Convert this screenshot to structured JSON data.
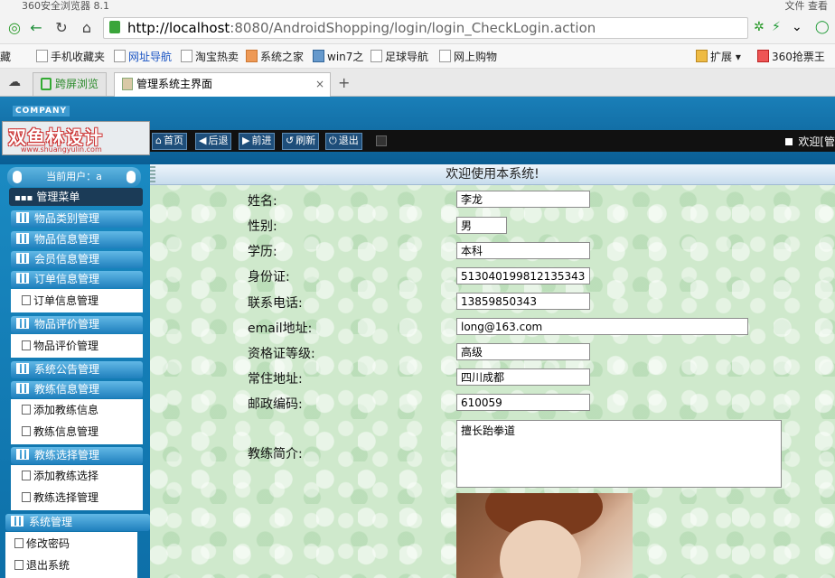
{
  "browser": {
    "title": "360安全浏览器 8.1",
    "title_right": "文件 查看",
    "url_host": "http://localhost",
    "url_path": ":8080/AndroidShopping/login/login_CheckLogin.action",
    "bookmarks": [
      {
        "label": "藏",
        "color": "normal"
      },
      {
        "label": "手机收藏夹",
        "color": "normal"
      },
      {
        "label": "网址导航",
        "color": "blue"
      },
      {
        "label": "淘宝热卖",
        "color": "normal"
      },
      {
        "label": "系统之家",
        "color": "normal"
      },
      {
        "label": "win7之",
        "color": "normal"
      },
      {
        "label": "足球导航",
        "color": "normal"
      },
      {
        "label": "网上购物",
        "color": "normal"
      }
    ],
    "extend_label": "扩展",
    "grab_label": "360抢票王",
    "tabs": [
      {
        "label": "跨屏浏览"
      },
      {
        "label": "管理系统主界面"
      }
    ],
    "new_tab": "+",
    "close_tab": "×"
  },
  "header": {
    "company_tag": "COMPANY",
    "logo_text": "双鱼林设计",
    "logo_url": "www.shuangyulin.com",
    "toolbar": [
      "首页",
      "后退",
      "前进",
      "刷新",
      "退出"
    ],
    "welcome": "欢迎[管"
  },
  "sidebar": {
    "current_user": "当前用户：a",
    "menu_title": "管理菜单",
    "sections": [
      {
        "label": "物品类别管理"
      },
      {
        "label": "物品信息管理"
      },
      {
        "label": "会员信息管理"
      },
      {
        "label": "订单信息管理",
        "items": [
          "订单信息管理"
        ]
      },
      {
        "label": "物品评价管理",
        "items": [
          "物品评价管理"
        ]
      },
      {
        "label": "系统公告管理"
      },
      {
        "label": "教练信息管理",
        "items": [
          "添加教练信息",
          "教练信息管理"
        ]
      },
      {
        "label": "教练选择管理",
        "items": [
          "添加教练选择",
          "教练选择管理"
        ]
      }
    ],
    "system": {
      "label": "系统管理",
      "items": [
        "修改密码",
        "退出系统"
      ]
    }
  },
  "main": {
    "title": "欢迎使用本系统!",
    "fields": [
      {
        "label": "姓名:",
        "value": "李龙"
      },
      {
        "label": "性别:",
        "value": "男"
      },
      {
        "label": "学历:",
        "value": "本科"
      },
      {
        "label": "身份证:",
        "value": "513040199812135343"
      },
      {
        "label": "联系电话:",
        "value": "13859850343"
      },
      {
        "label": "email地址:",
        "value": "long@163.com"
      },
      {
        "label": "资格证等级:",
        "value": "高级"
      },
      {
        "label": "常住地址:",
        "value": "四川成都"
      },
      {
        "label": "邮政编码:",
        "value": "610059"
      }
    ],
    "intro_label": "教练简介:",
    "intro_value": "擅长跆拳道"
  },
  "colors": {
    "header_blue": "#1a7fb8",
    "toolbar_black": "#111111",
    "content_green": "#cfe9cc",
    "menu_blue": "#1f7fbd"
  }
}
